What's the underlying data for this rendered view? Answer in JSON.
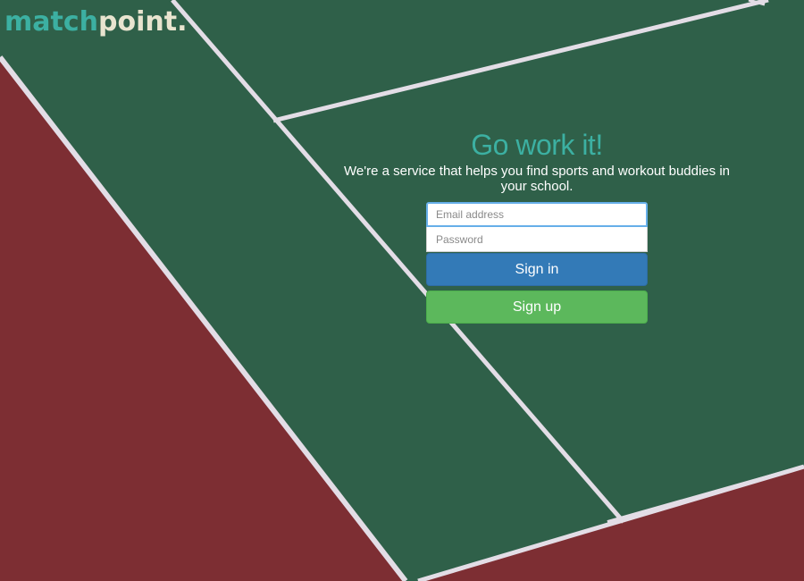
{
  "brand": {
    "name_part1": "match",
    "name_part2": "point."
  },
  "hero": {
    "headline": "Go work it!",
    "tagline": "We're a service that helps you find sports and workout buddies in your school."
  },
  "login_form": {
    "email_placeholder": "Email address",
    "email_value": "",
    "password_placeholder": "Password",
    "password_value": "",
    "sign_in_label": "Sign in",
    "sign_up_label": "Sign up"
  },
  "colors": {
    "accent": "#3cb0a2",
    "logo_secondary": "#e8e4cf",
    "court_green": "#2f6049",
    "court_red": "#7d2e33",
    "court_lines": "#e3dde6",
    "sign_in": "#337ab7",
    "sign_up": "#5cb85c"
  }
}
